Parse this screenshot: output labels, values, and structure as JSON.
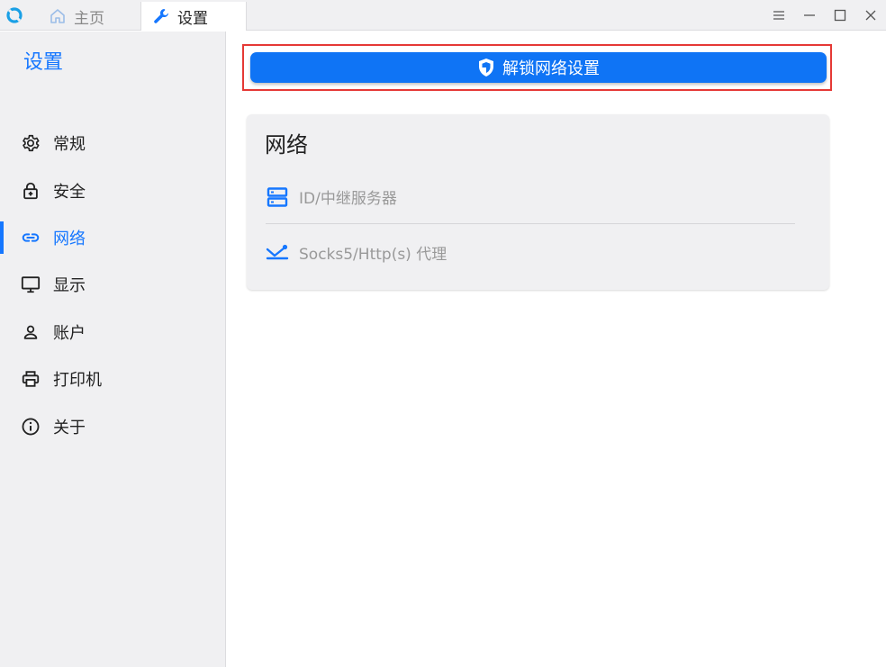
{
  "titlebar": {
    "tabs": [
      {
        "label": "主页",
        "icon": "home-icon"
      },
      {
        "label": "设置",
        "icon": "wrench-icon"
      }
    ],
    "window_controls": [
      "menu-icon",
      "minimize-icon",
      "maximize-icon",
      "close-icon"
    ]
  },
  "sidebar": {
    "title": "设置",
    "items": [
      {
        "label": "常规",
        "icon": "gear-icon"
      },
      {
        "label": "安全",
        "icon": "lock-icon"
      },
      {
        "label": "网络",
        "icon": "link-icon",
        "active": true
      },
      {
        "label": "显示",
        "icon": "monitor-icon"
      },
      {
        "label": "账户",
        "icon": "user-icon"
      },
      {
        "label": "打印机",
        "icon": "printer-icon"
      },
      {
        "label": "关于",
        "icon": "info-icon"
      }
    ]
  },
  "main": {
    "unlock_button": {
      "label": "解锁网络设置",
      "icon": "shield-icon"
    },
    "network_card": {
      "title": "网络",
      "rows": [
        {
          "label": "ID/中继服务器",
          "icon": "server-icon"
        },
        {
          "label": "Socks5/Http(s) 代理",
          "icon": "proxy-icon"
        }
      ]
    }
  },
  "colors": {
    "accent": "#1677ff",
    "button": "#0f74f5",
    "highlight_frame": "#e53935",
    "sidebar_bg": "#f0f0f2"
  }
}
